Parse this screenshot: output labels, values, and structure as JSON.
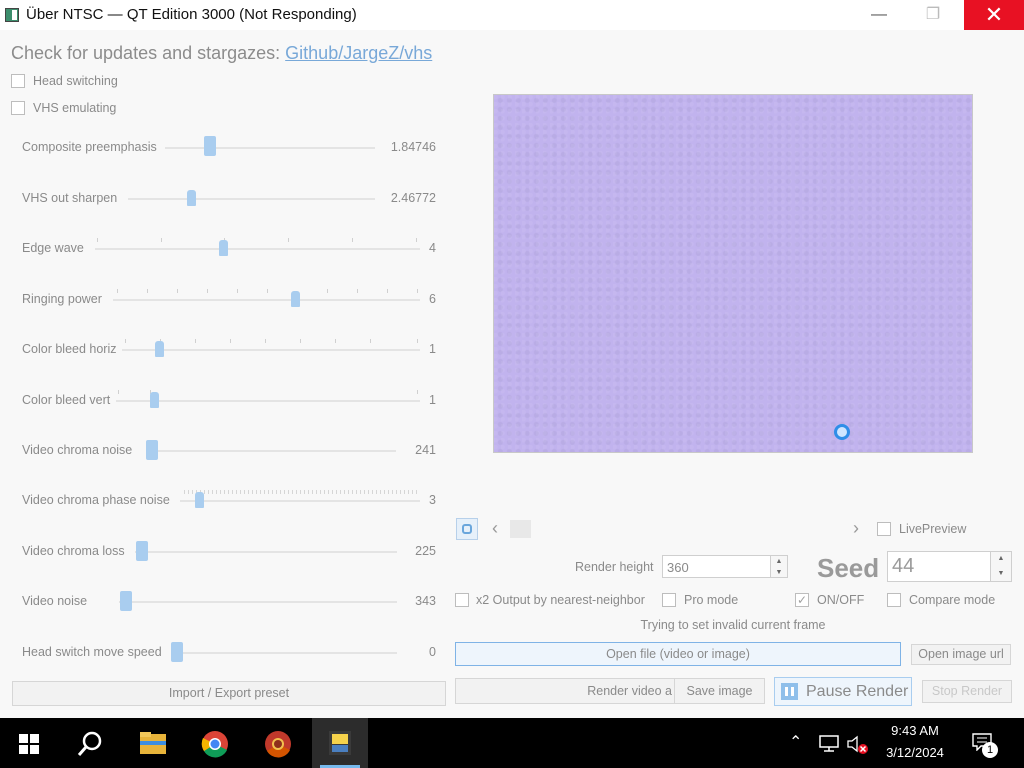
{
  "window": {
    "title": "Über NTSC — QT Edition 3000 (Not Responding)",
    "minimize": "—",
    "maximize": "❐",
    "close": "✕"
  },
  "header": {
    "update_text": "Check for updates and stargazes: ",
    "update_link": "Github/JargeZ/vhs"
  },
  "checkboxes": {
    "head_switching": "Head switching",
    "vhs_emulating": "VHS emulating"
  },
  "sliders": [
    {
      "label": "Composite preemphasis",
      "value": "1.84746"
    },
    {
      "label": "VHS out sharpen",
      "value": "2.46772"
    },
    {
      "label": "Edge wave",
      "value": "4"
    },
    {
      "label": "Ringing power",
      "value": "6"
    },
    {
      "label": "Color bleed horiz",
      "value": "1"
    },
    {
      "label": "Color bleed vert",
      "value": "1"
    },
    {
      "label": "Video chroma noise",
      "value": "241"
    },
    {
      "label": "Video chroma phase noise",
      "value": "3"
    },
    {
      "label": "Video chroma loss",
      "value": "225"
    },
    {
      "label": "Video noise",
      "value": "343"
    },
    {
      "label": "Head switch move speed",
      "value": "0"
    }
  ],
  "import_export": "Import / Export preset",
  "nav": {
    "prev": "‹",
    "next": "›",
    "live_preview": "LivePreview"
  },
  "render": {
    "height_label": "Render height",
    "height_value": "360",
    "seed_label": "Seed",
    "seed_value": "44"
  },
  "options": {
    "x2_output": "x2 Output by nearest-neighbor",
    "pro_mode": "Pro mode",
    "on_off": "ON/OFF",
    "compare_mode": "Compare mode"
  },
  "status": "Trying to set invalid current frame",
  "buttons": {
    "open_file": "Open file (video or image)",
    "open_image_url": "Open image url",
    "render_video": "Render video a",
    "save_image": "Save image",
    "pause_render": "Pause Render",
    "stop_render": "Stop Render"
  },
  "taskbar": {
    "time": "9:43 AM",
    "date": "3/12/2024",
    "notifications": "1"
  }
}
